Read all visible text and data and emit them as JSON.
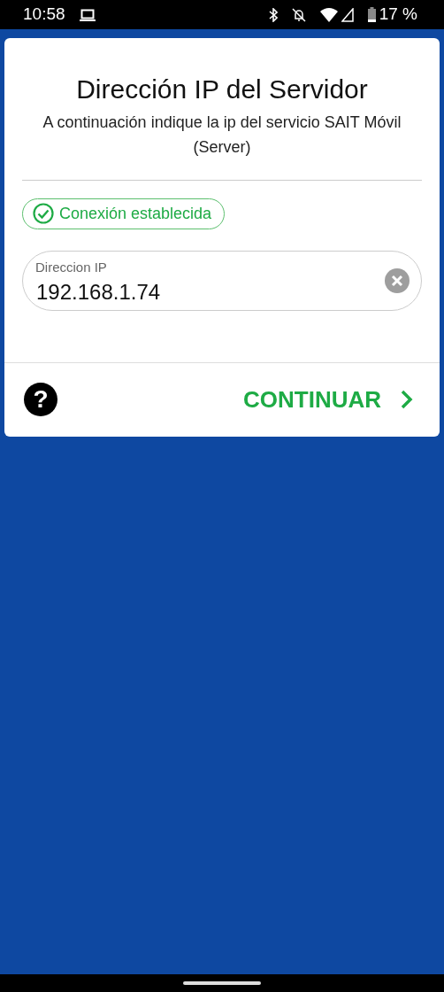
{
  "status_bar": {
    "time": "10:58",
    "battery": "17 %"
  },
  "dialog": {
    "title": "Dirección IP del Servidor",
    "subtitle": "A continuación indique la ip del servicio SAIT Móvil (Server)",
    "connection": {
      "text": "Conexión establecida",
      "connected": true
    },
    "ip_field": {
      "label": "Direccion IP",
      "value": "192.168.1.74"
    },
    "help_button": {
      "label": "?"
    },
    "continue_button": {
      "label": "CONTINUAR"
    }
  }
}
